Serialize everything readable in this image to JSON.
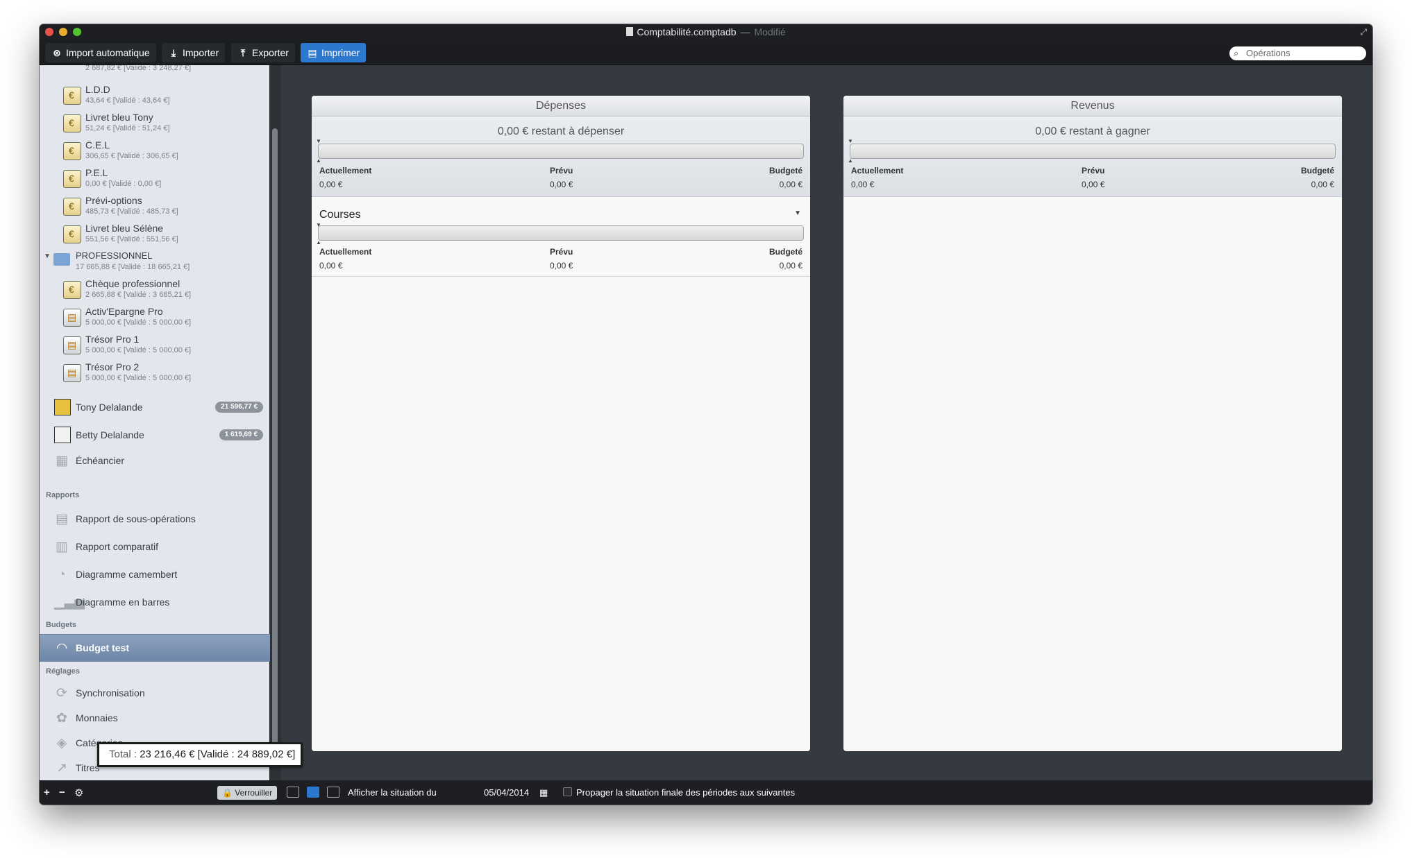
{
  "window": {
    "title": "Comptabilité.comptadb",
    "title_sep": "—",
    "modified": "Modifié"
  },
  "toolbar": {
    "import_auto": "Import automatique",
    "import": "Importer",
    "export": "Exporter",
    "print": "Imprimer",
    "search_placeholder": "Opérations"
  },
  "sidebar": {
    "partial_top": "2 687,82 € [Validé : 3 248,27 €]",
    "accounts_top": [
      {
        "name": "L.D.D",
        "sub": "43,64 € [Validé : 43,64 €]",
        "icon": "savings-book-icon"
      },
      {
        "name": "Livret bleu Tony",
        "sub": "51,24 € [Validé : 51,24 €]",
        "icon": "savings-book-icon"
      },
      {
        "name": "C.E.L",
        "sub": "306,65 € [Validé : 306,65 €]",
        "icon": "savings-book-icon"
      },
      {
        "name": "P.E.L",
        "sub": "0,00 € [Validé : 0,00 €]",
        "icon": "savings-book-icon"
      },
      {
        "name": "Prévi-options",
        "sub": "485,73 € [Validé : 485,73 €]",
        "icon": "savings-book-icon"
      },
      {
        "name": "Livret bleu Sélène",
        "sub": "551,56 € [Validé : 551,56 €]",
        "icon": "savings-book-icon"
      }
    ],
    "group": {
      "name": "PROFESSIONNEL",
      "sub": "17 665,88 € [Validé : 18 665,21 €]"
    },
    "accounts_pro": [
      {
        "name": "Chèque professionnel",
        "sub": "2 665,88 € [Validé : 3 665,21 €]",
        "icon": "checkbook-icon"
      },
      {
        "name": "Activ'Epargne Pro",
        "sub": "5 000,00 € [Validé : 5 000,00 €]",
        "icon": "safe-icon"
      },
      {
        "name": "Trésor Pro 1",
        "sub": "5 000,00 € [Validé : 5 000,00 €]",
        "icon": "safe-icon"
      },
      {
        "name": "Trésor Pro 2",
        "sub": "5 000,00 € [Validé : 5 000,00 €]",
        "icon": "safe-icon"
      }
    ],
    "people": [
      {
        "name": "Tony Delalande",
        "badge": "21 596,77 €"
      },
      {
        "name": "Betty Delalande",
        "badge": "1 619,69 €"
      }
    ],
    "scheduler": "Échéancier",
    "reports_head": "Rapports",
    "reports": [
      "Rapport de sous-opérations",
      "Rapport comparatif",
      "Diagramme camembert",
      "Diagramme en barres"
    ],
    "budgets_head": "Budgets",
    "budget_selected": "Budget test",
    "settings_head": "Réglages",
    "settings": [
      "Synchronisation",
      "Monnaies",
      "Catégories",
      "Titres"
    ],
    "total_label": "Total :",
    "total_value": "23 216,46 € [Validé : 24 889,02 €]",
    "lock": "Verrouiller"
  },
  "bottom": {
    "show_situation": "Afficher la situation du",
    "date": "05/04/2014",
    "propagate": "Propager la situation finale des périodes aux suivantes"
  },
  "expenses": {
    "title": "Dépenses",
    "remaining": "0,00 € restant à dépenser",
    "col_current": "Actuellement",
    "col_planned": "Prévu",
    "col_budget": "Budgeté",
    "current": "0,00 €",
    "planned": "0,00 €",
    "budget": "0,00 €",
    "category": {
      "name": "Courses",
      "current": "0,00 €",
      "planned": "0,00 €",
      "budget": "0,00 €"
    }
  },
  "income": {
    "title": "Revenus",
    "remaining": "0,00 € restant à gagner",
    "col_current": "Actuellement",
    "col_planned": "Prévu",
    "col_budget": "Budgeté",
    "current": "0,00 €",
    "planned": "0,00 €",
    "budget": "0,00 €"
  }
}
